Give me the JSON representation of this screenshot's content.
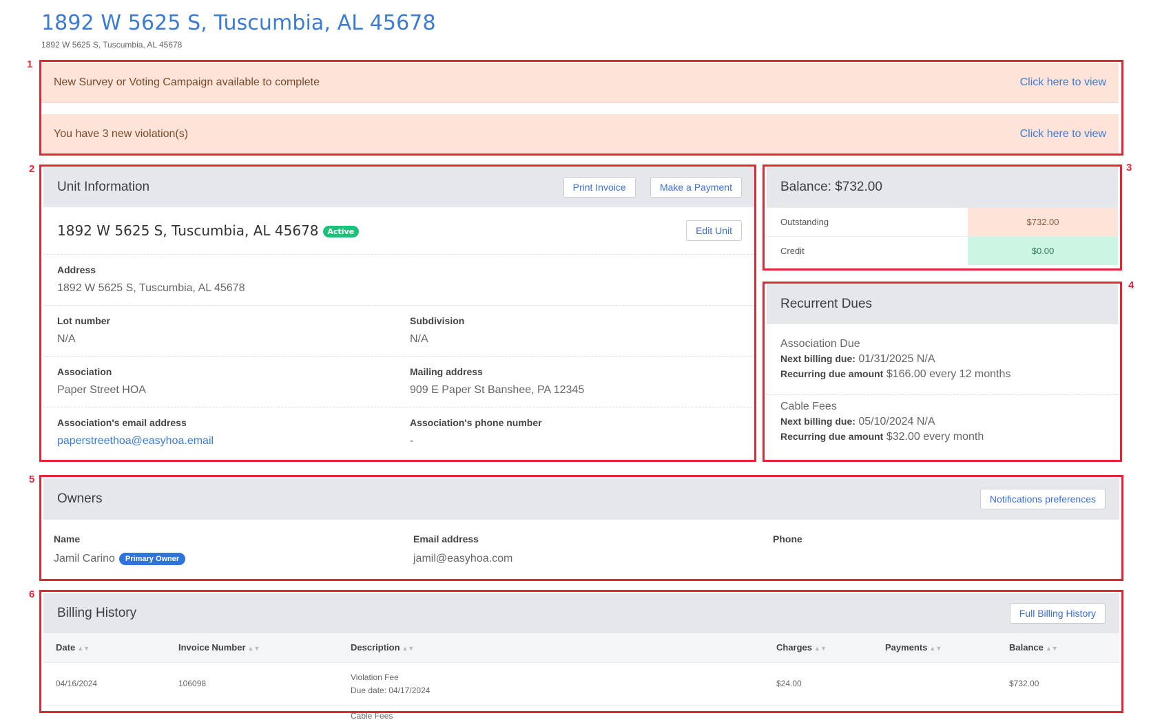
{
  "header": {
    "title": "1892 W 5625 S, Tuscumbia, AL 45678",
    "subtitle": "1892 W 5625 S, Tuscumbia, AL 45678"
  },
  "callouts": [
    "1",
    "2",
    "3",
    "4",
    "5",
    "6"
  ],
  "alerts": [
    {
      "text": "New Survey or Voting Campaign available to complete",
      "link": "Click here to view"
    },
    {
      "text": "You have 3 new violation(s)",
      "link": "Click here to view"
    }
  ],
  "unit_info": {
    "title": "Unit Information",
    "print_invoice": "Print Invoice",
    "make_payment": "Make a Payment",
    "unit_name": "1892 W 5625 S, Tuscumbia, AL 45678",
    "status": "Active",
    "edit_unit": "Edit Unit",
    "address_label": "Address",
    "address_value": "1892 W 5625 S, Tuscumbia, AL 45678",
    "lot_label": "Lot number",
    "lot_value": "N/A",
    "subdivision_label": "Subdivision",
    "subdivision_value": "N/A",
    "association_label": "Association",
    "association_value": "Paper Street HOA",
    "mailing_label": "Mailing address",
    "mailing_value": "909 E Paper St Banshee, PA 12345",
    "email_label": "Association's email address",
    "email_value": "paperstreethoa@easyhoa.email",
    "phone_label": "Association's phone number",
    "phone_value": "-"
  },
  "balance": {
    "title": "Balance: $732.00",
    "outstanding_label": "Outstanding",
    "outstanding_value": "$732.00",
    "credit_label": "Credit",
    "credit_value": "$0.00",
    "outstanding_color": "#fde3d8",
    "credit_color": "#cdf5e3"
  },
  "recurrent_dues": {
    "title": "Recurrent Dues",
    "items": [
      {
        "name": "Association Due",
        "next_label": "Next billing due:",
        "next_value": "01/31/2025 N/A",
        "amount_label": "Recurring due amount",
        "amount_value": "$166.00 every 12 months"
      },
      {
        "name": "Cable Fees",
        "next_label": "Next billing due:",
        "next_value": "05/10/2024 N/A",
        "amount_label": "Recurring due amount",
        "amount_value": "$32.00 every month"
      }
    ]
  },
  "owners": {
    "title": "Owners",
    "notifications_button": "Notifications preferences",
    "columns": [
      "Name",
      "Email address",
      "Phone"
    ],
    "rows": [
      {
        "name": "Jamil Carino",
        "badge": "Primary Owner",
        "email": "jamil@easyhoa.com",
        "phone": ""
      }
    ]
  },
  "billing": {
    "title": "Billing History",
    "full_button": "Full Billing History",
    "columns": [
      "Date",
      "Invoice Number",
      "Description",
      "Charges",
      "Payments",
      "Balance"
    ],
    "rows": [
      {
        "date": "04/16/2024",
        "invoice": "106098",
        "desc": "Violation Fee",
        "due": "Due date: 04/17/2024",
        "charges": "$24.00",
        "payments": "",
        "balance": "$732.00"
      }
    ],
    "next_row_partial": "Cable Fees"
  },
  "colors": {
    "accent": "#3a7bd5",
    "callout": "#e32636",
    "active_badge": "#1ec17a",
    "primary_badge": "#2f74d8"
  }
}
